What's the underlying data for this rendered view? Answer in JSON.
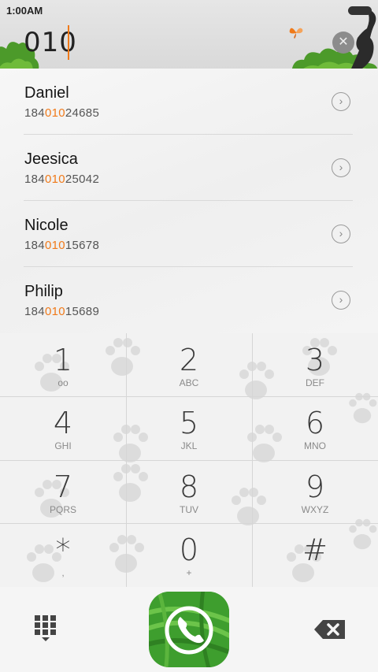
{
  "status_bar": {
    "time": "1:00AM"
  },
  "dialer": {
    "input": "010"
  },
  "contacts": [
    {
      "name": "Daniel",
      "number_prefix": "184",
      "number_match": "010",
      "number_suffix": "24685"
    },
    {
      "name": "Jeesica",
      "number_prefix": "184",
      "number_match": "010",
      "number_suffix": "25042"
    },
    {
      "name": "Nicole",
      "number_prefix": "184",
      "number_match": "010",
      "number_suffix": "15678"
    },
    {
      "name": "Philip",
      "number_prefix": "184",
      "number_match": "010",
      "number_suffix": "15689"
    }
  ],
  "keys": [
    {
      "digit": "1",
      "letters": "oo"
    },
    {
      "digit": "2",
      "letters": "ABC"
    },
    {
      "digit": "3",
      "letters": "DEF"
    },
    {
      "digit": "4",
      "letters": "GHI"
    },
    {
      "digit": "5",
      "letters": "JKL"
    },
    {
      "digit": "6",
      "letters": "MNO"
    },
    {
      "digit": "7",
      "letters": "PQRS"
    },
    {
      "digit": "8",
      "letters": "TUV"
    },
    {
      "digit": "9",
      "letters": "WXYZ"
    },
    {
      "digit": "*",
      "letters": ","
    },
    {
      "digit": "0",
      "letters": "+"
    },
    {
      "digit": "#",
      "letters": ""
    }
  ],
  "icons": {
    "clear": "clear-icon",
    "contact_detail": "chevron-right-icon",
    "dialpad_toggle": "dialpad-icon",
    "call": "phone-icon",
    "backspace": "backspace-icon"
  },
  "colors": {
    "highlight": "#f07a1a",
    "call_green": "#3e9e2e",
    "text_dark": "#151515",
    "text_gray": "#555555"
  }
}
